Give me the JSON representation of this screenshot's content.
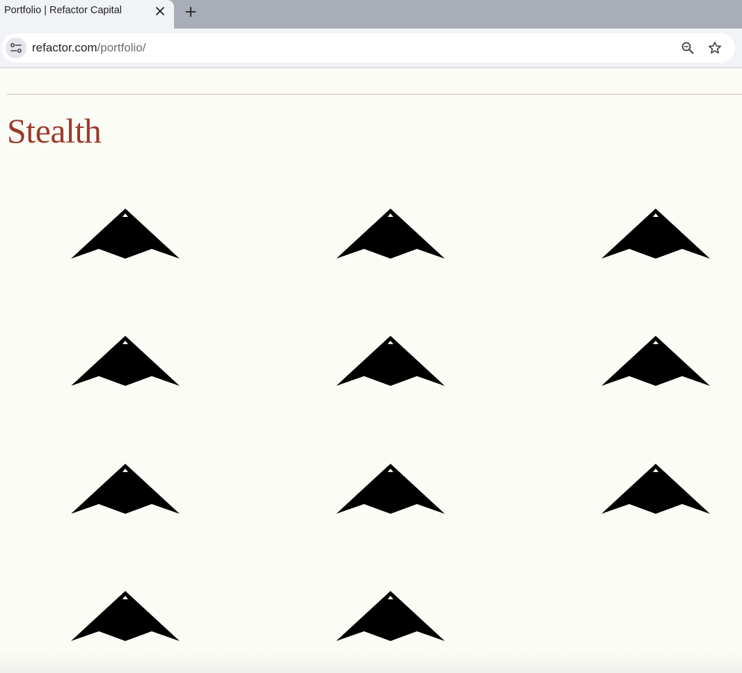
{
  "browser": {
    "tab": {
      "title": "Portfolio | Refactor Capital",
      "close_icon": "close-icon"
    },
    "new_tab_icon": "plus-icon",
    "address_bar": {
      "site_info_icon": "tune-icon",
      "url_host": "refactor.com",
      "url_path": "/portfolio/",
      "zoom_icon": "zoom-out-icon",
      "bookmark_icon": "star-icon"
    }
  },
  "page": {
    "section_title": "Stealth",
    "title_color": "#9b3b2a",
    "companies": [
      {
        "logo": "stealth-bomber-icon"
      },
      {
        "logo": "stealth-bomber-icon"
      },
      {
        "logo": "stealth-bomber-icon"
      },
      {
        "logo": "stealth-bomber-icon"
      },
      {
        "logo": "stealth-bomber-icon"
      },
      {
        "logo": "stealth-bomber-icon"
      },
      {
        "logo": "stealth-bomber-icon"
      },
      {
        "logo": "stealth-bomber-icon"
      },
      {
        "logo": "stealth-bomber-icon"
      },
      {
        "logo": "stealth-bomber-icon"
      },
      {
        "logo": "stealth-bomber-icon"
      }
    ]
  }
}
